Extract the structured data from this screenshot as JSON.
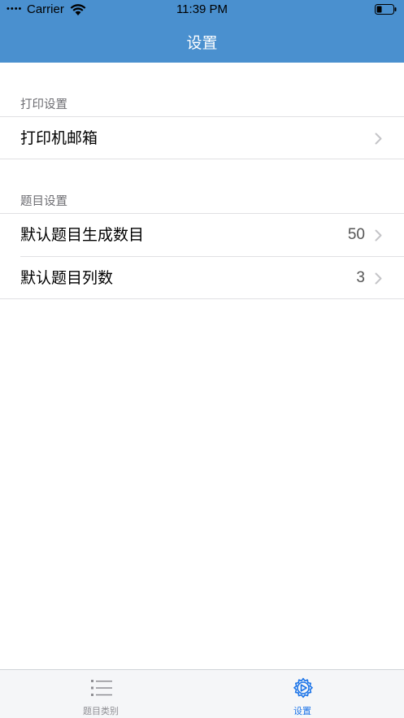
{
  "status_bar": {
    "signal": "••••",
    "carrier": "Carrier",
    "time": "11:39 PM"
  },
  "nav": {
    "title": "设置"
  },
  "sections": [
    {
      "header": "打印设置",
      "rows": [
        {
          "label": "打印机邮箱",
          "value": ""
        }
      ]
    },
    {
      "header": "题目设置",
      "rows": [
        {
          "label": "默认题目生成数目",
          "value": "50"
        },
        {
          "label": "默认题目列数",
          "value": "3"
        }
      ]
    }
  ],
  "tabbar": {
    "tabs": [
      {
        "label": "题目类别",
        "icon": "list-icon",
        "selected": false
      },
      {
        "label": "设置",
        "icon": "settings-gear-icon",
        "selected": true
      }
    ]
  },
  "colors": {
    "nav_background": "#4a90cf",
    "tab_selected": "#1a73e8",
    "tab_unselected": "#8e8e93"
  }
}
